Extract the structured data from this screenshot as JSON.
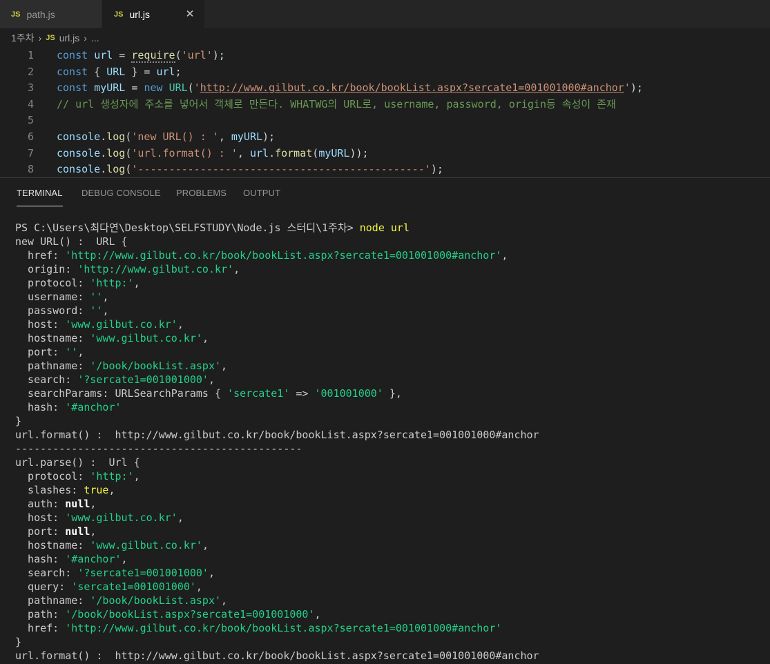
{
  "tabs": [
    {
      "icon": "JS",
      "label": "path.js"
    },
    {
      "icon": "JS",
      "label": "url.js",
      "close": "✕"
    }
  ],
  "breadcrumb": {
    "folder": "1주차",
    "file": "url.js",
    "more": "..."
  },
  "editor": {
    "line_numbers": [
      "1",
      "2",
      "3",
      "4",
      "5",
      "6",
      "7",
      "8"
    ]
  },
  "panel": {
    "tabs": [
      "TERMINAL",
      "DEBUG CONSOLE",
      "PROBLEMS",
      "OUTPUT"
    ]
  },
  "terminal": {
    "prompt": "PS C:\\Users\\최다연\\Desktop\\SELFSTUDY\\Node.js 스터디\\1주차> ",
    "command": "node url",
    "lines": [
      [
        {
          "c": "tc",
          "t": "new URL() :  URL {"
        }
      ],
      [
        {
          "c": "tc",
          "t": "  href: "
        },
        {
          "c": "tg",
          "t": "'http://www.gilbut.co.kr/book/bookList.aspx?sercate1=001001000#anchor'"
        },
        {
          "c": "tc",
          "t": ","
        }
      ],
      [
        {
          "c": "tc",
          "t": "  origin: "
        },
        {
          "c": "tg",
          "t": "'http://www.gilbut.co.kr'"
        },
        {
          "c": "tc",
          "t": ","
        }
      ],
      [
        {
          "c": "tc",
          "t": "  protocol: "
        },
        {
          "c": "tg",
          "t": "'http:'"
        },
        {
          "c": "tc",
          "t": ","
        }
      ],
      [
        {
          "c": "tc",
          "t": "  username: "
        },
        {
          "c": "tg",
          "t": "''"
        },
        {
          "c": "tc",
          "t": ","
        }
      ],
      [
        {
          "c": "tc",
          "t": "  password: "
        },
        {
          "c": "tg",
          "t": "''"
        },
        {
          "c": "tc",
          "t": ","
        }
      ],
      [
        {
          "c": "tc",
          "t": "  host: "
        },
        {
          "c": "tg",
          "t": "'www.gilbut.co.kr'"
        },
        {
          "c": "tc",
          "t": ","
        }
      ],
      [
        {
          "c": "tc",
          "t": "  hostname: "
        },
        {
          "c": "tg",
          "t": "'www.gilbut.co.kr'"
        },
        {
          "c": "tc",
          "t": ","
        }
      ],
      [
        {
          "c": "tc",
          "t": "  port: "
        },
        {
          "c": "tg",
          "t": "''"
        },
        {
          "c": "tc",
          "t": ","
        }
      ],
      [
        {
          "c": "tc",
          "t": "  pathname: "
        },
        {
          "c": "tg",
          "t": "'/book/bookList.aspx'"
        },
        {
          "c": "tc",
          "t": ","
        }
      ],
      [
        {
          "c": "tc",
          "t": "  search: "
        },
        {
          "c": "tg",
          "t": "'?sercate1=001001000'"
        },
        {
          "c": "tc",
          "t": ","
        }
      ],
      [
        {
          "c": "tc",
          "t": "  searchParams: URLSearchParams { "
        },
        {
          "c": "tg",
          "t": "'sercate1'"
        },
        {
          "c": "tc",
          "t": " => "
        },
        {
          "c": "tg",
          "t": "'001001000'"
        },
        {
          "c": "tc",
          "t": " },"
        }
      ],
      [
        {
          "c": "tc",
          "t": "  hash: "
        },
        {
          "c": "tg",
          "t": "'#anchor'"
        }
      ],
      [
        {
          "c": "tc",
          "t": "}"
        }
      ],
      [
        {
          "c": "tc",
          "t": "url.format() :  http://www.gilbut.co.kr/book/bookList.aspx?sercate1=001001000#anchor"
        }
      ],
      [
        {
          "c": "tc",
          "t": "----------------------------------------------"
        }
      ],
      [
        {
          "c": "tc",
          "t": "url.parse() :  Url {"
        }
      ],
      [
        {
          "c": "tc",
          "t": "  protocol: "
        },
        {
          "c": "tg",
          "t": "'http:'"
        },
        {
          "c": "tc",
          "t": ","
        }
      ],
      [
        {
          "c": "tc",
          "t": "  slashes: "
        },
        {
          "c": "ty",
          "t": "true"
        },
        {
          "c": "tc",
          "t": ","
        }
      ],
      [
        {
          "c": "tc",
          "t": "  auth: "
        },
        {
          "c": "tw",
          "t": "null"
        },
        {
          "c": "tc",
          "t": ","
        }
      ],
      [
        {
          "c": "tc",
          "t": "  host: "
        },
        {
          "c": "tg",
          "t": "'www.gilbut.co.kr'"
        },
        {
          "c": "tc",
          "t": ","
        }
      ],
      [
        {
          "c": "tc",
          "t": "  port: "
        },
        {
          "c": "tw",
          "t": "null"
        },
        {
          "c": "tc",
          "t": ","
        }
      ],
      [
        {
          "c": "tc",
          "t": "  hostname: "
        },
        {
          "c": "tg",
          "t": "'www.gilbut.co.kr'"
        },
        {
          "c": "tc",
          "t": ","
        }
      ],
      [
        {
          "c": "tc",
          "t": "  hash: "
        },
        {
          "c": "tg",
          "t": "'#anchor'"
        },
        {
          "c": "tc",
          "t": ","
        }
      ],
      [
        {
          "c": "tc",
          "t": "  search: "
        },
        {
          "c": "tg",
          "t": "'?sercate1=001001000'"
        },
        {
          "c": "tc",
          "t": ","
        }
      ],
      [
        {
          "c": "tc",
          "t": "  query: "
        },
        {
          "c": "tg",
          "t": "'sercate1=001001000'"
        },
        {
          "c": "tc",
          "t": ","
        }
      ],
      [
        {
          "c": "tc",
          "t": "  pathname: "
        },
        {
          "c": "tg",
          "t": "'/book/bookList.aspx'"
        },
        {
          "c": "tc",
          "t": ","
        }
      ],
      [
        {
          "c": "tc",
          "t": "  path: "
        },
        {
          "c": "tg",
          "t": "'/book/bookList.aspx?sercate1=001001000'"
        },
        {
          "c": "tc",
          "t": ","
        }
      ],
      [
        {
          "c": "tc",
          "t": "  href: "
        },
        {
          "c": "tg",
          "t": "'http://www.gilbut.co.kr/book/bookList.aspx?sercate1=001001000#anchor'"
        }
      ],
      [
        {
          "c": "tc",
          "t": "}"
        }
      ],
      [
        {
          "c": "tc",
          "t": "url.format() :  http://www.gilbut.co.kr/book/bookList.aspx?sercate1=001001000#anchor"
        }
      ]
    ]
  }
}
